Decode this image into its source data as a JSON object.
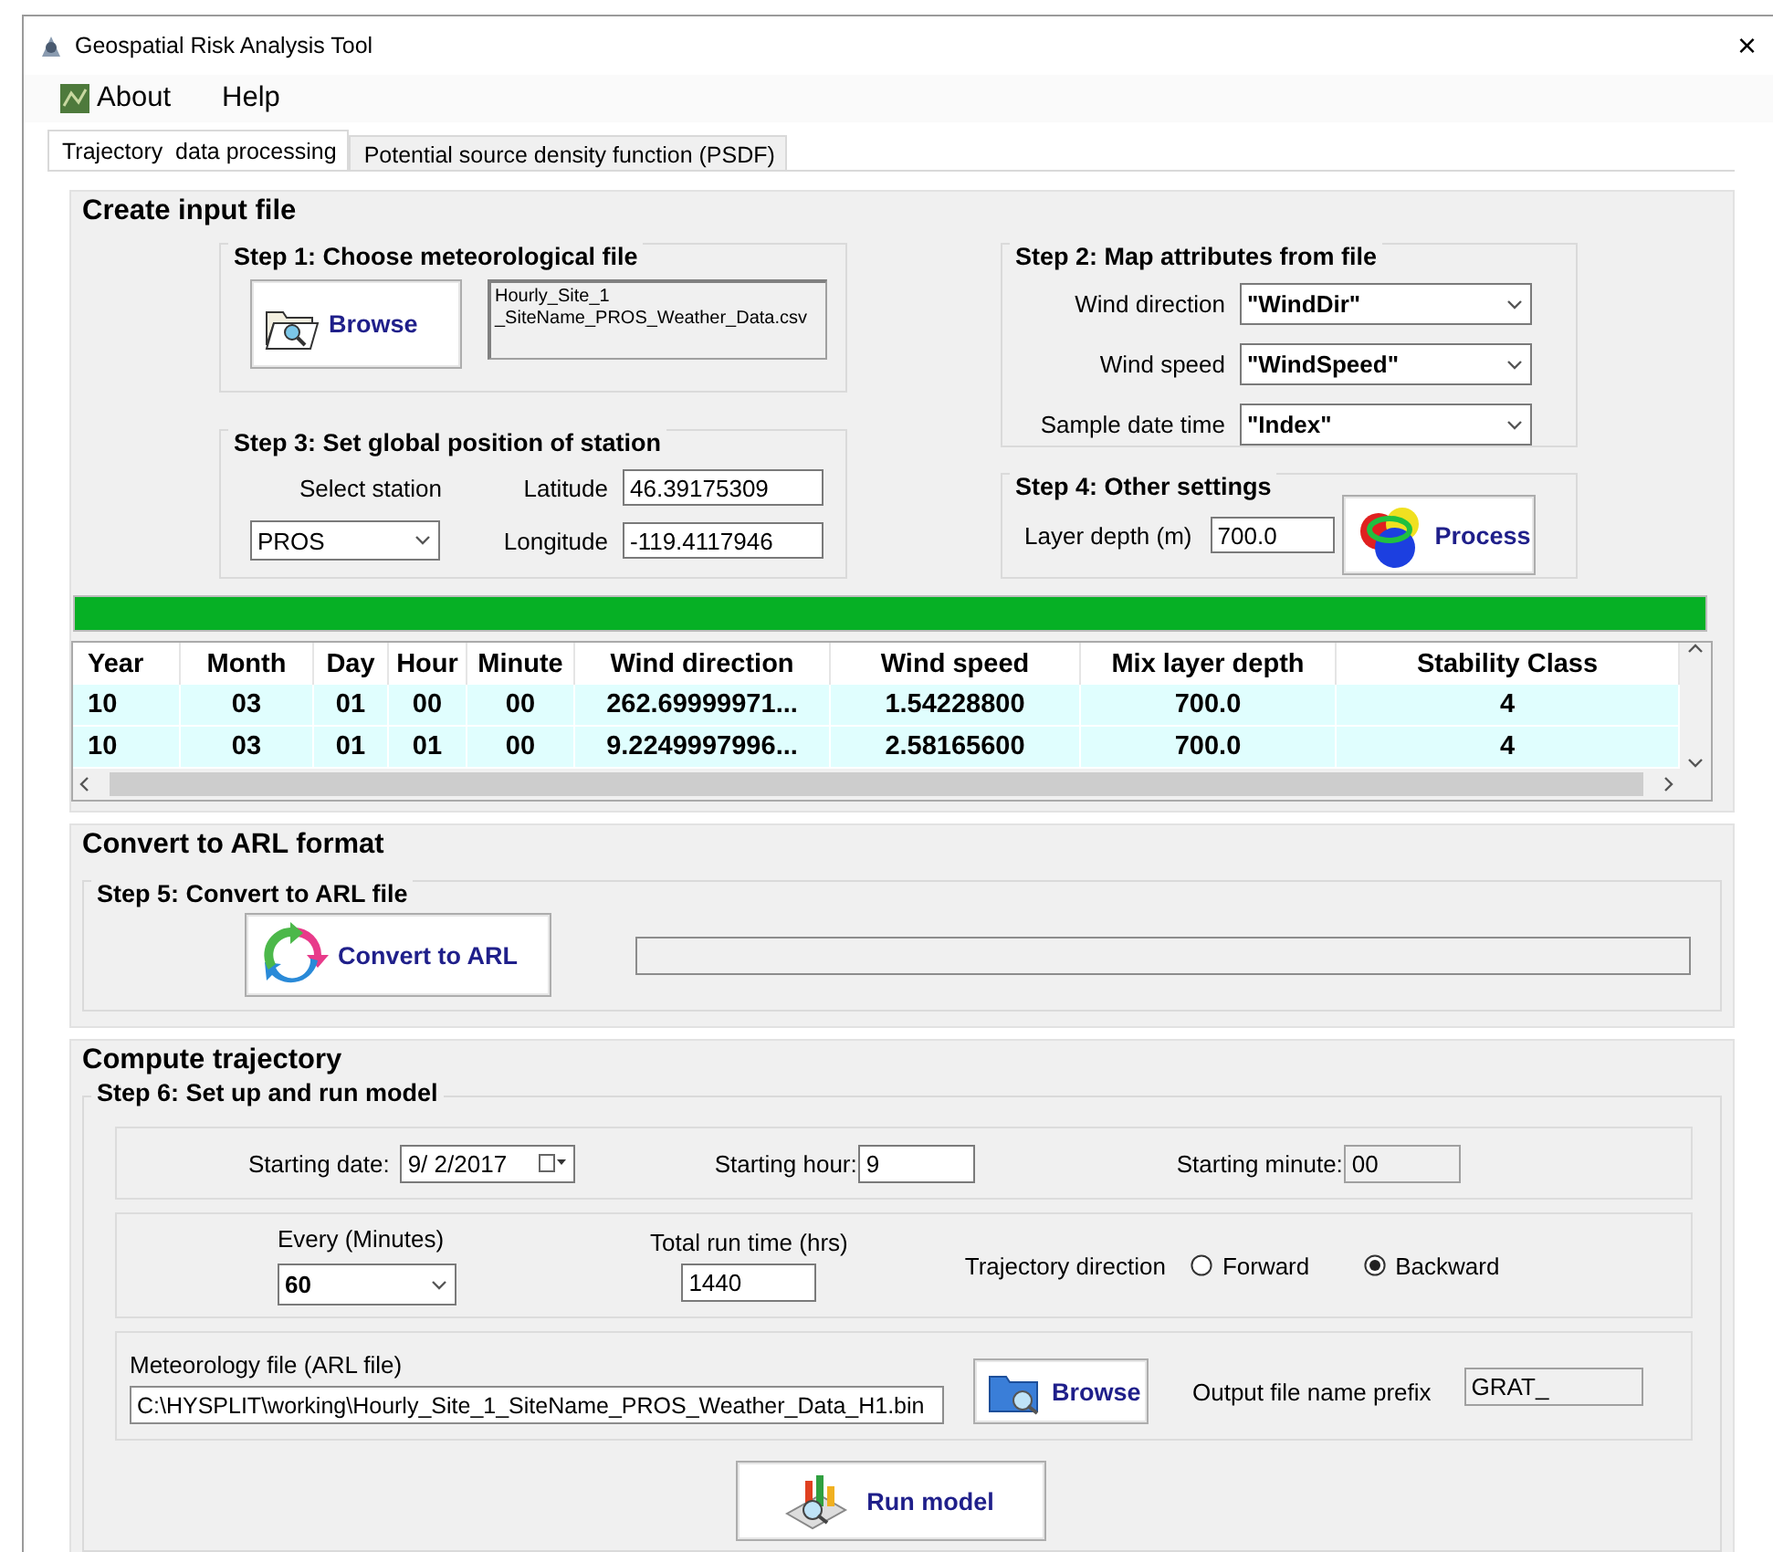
{
  "window": {
    "title": "Geospatial Risk Analysis Tool",
    "close": "×"
  },
  "menu": [
    {
      "label": "About",
      "kind": "icon"
    },
    {
      "label": "Help",
      "kind": "plain"
    }
  ],
  "tabs": [
    {
      "label": "Trajectory  data processing",
      "selected": true
    },
    {
      "label": "Potential source density function (PSDF)",
      "selected": false
    }
  ],
  "create_input": {
    "title": "Create input file",
    "step1": {
      "title": "Step 1: Choose meteorological file",
      "browse": "Browse",
      "file": "Hourly_Site_1\n_SiteName_PROS_Weather_Data.csv"
    },
    "step3": {
      "title": "Step 3: Set global position of station",
      "station_label": "Select station",
      "station": "PROS",
      "latitude_label": "Latitude",
      "latitude": "46.39175309",
      "longitude_label": "Longitude",
      "longitude": "-119.4117946"
    },
    "step2": {
      "title": "Step 2: Map attributes from file",
      "fields": [
        {
          "label": "Wind direction",
          "value": "\"WindDir\""
        },
        {
          "label": "Wind speed",
          "value": "\"WindSpeed\""
        },
        {
          "label": "Sample date time",
          "value": "\"Index\""
        }
      ]
    },
    "step4": {
      "title": "Step 4: Other settings",
      "layer_label": "Layer depth (m)",
      "layer": "700.0",
      "process": "Process"
    },
    "progress": {
      "level": 1
    },
    "table": {
      "columns": [
        "Year",
        "Month",
        "Day",
        "Hour",
        "Minute",
        "Wind direction",
        "Wind speed",
        "Mix layer depth",
        "Stability Class"
      ],
      "rows": [
        [
          "10",
          "03",
          "01",
          "00",
          "00",
          "262.69999971...",
          "1.54228800",
          "700.0",
          "4"
        ],
        [
          "10",
          "03",
          "01",
          "01",
          "00",
          "9.2249997996...",
          "2.58165600",
          "700.0",
          "4"
        ]
      ]
    }
  },
  "convert": {
    "title": "Convert to ARL format",
    "step5": "Step 5: Convert to ARL file",
    "button": "Convert to ARL",
    "progress": {
      "level": 0
    }
  },
  "compute": {
    "title": "Compute trajectory",
    "step6": "Step 6: Set up and run model",
    "starting_date": {
      "label": "Starting date:",
      "value": "9/ 2/2017"
    },
    "starting_hour": {
      "label": "Starting hour:",
      "value": "9",
      "disabled": false
    },
    "starting_minute": {
      "label": "Starting minute:",
      "value": "00",
      "disabled": true
    },
    "every": {
      "label": "Every (Minutes)",
      "value": "60"
    },
    "run_time": {
      "label": "Total run time (hrs)",
      "value": "1440"
    },
    "direction": {
      "label": "Trajectory direction",
      "options": [
        {
          "label": "Forward",
          "selected": false
        },
        {
          "label": "Backward",
          "selected": true
        }
      ]
    },
    "met_file": {
      "label": "Meteorology file (ARL file)",
      "value": "C:\\HYSPLIT\\working\\Hourly_Site_1_SiteName_PROS_Weather_Data_H1.bin"
    },
    "browse": "Browse",
    "prefix": {
      "label": "Output file name prefix",
      "value": "GRAT_",
      "disabled": true
    },
    "run": "Run model"
  }
}
